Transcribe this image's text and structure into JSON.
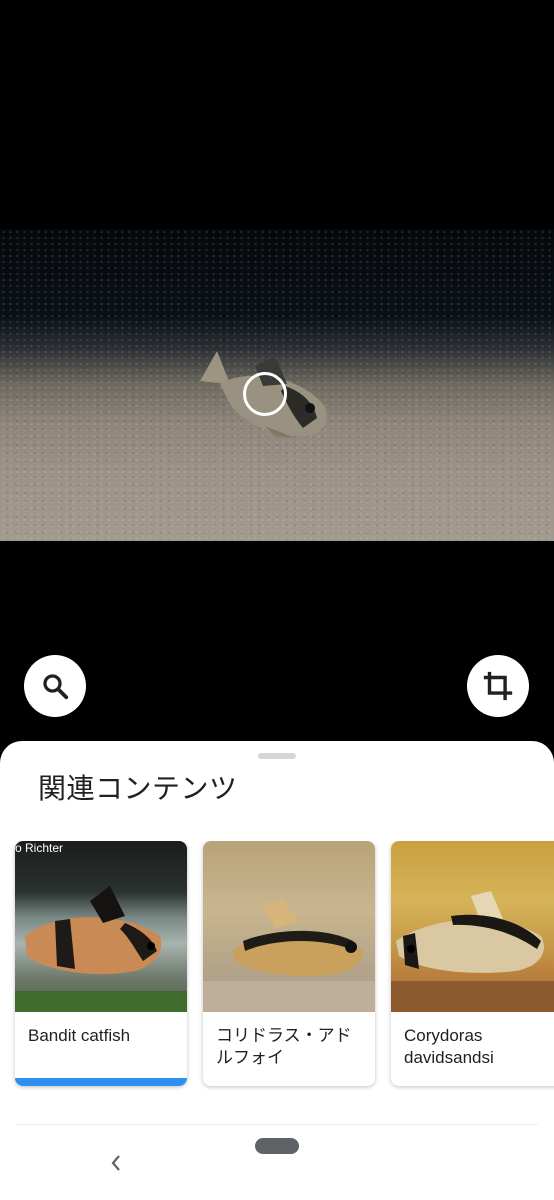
{
  "viewer": {
    "search_icon": "search-icon",
    "crop_icon": "crop-icon"
  },
  "sheet": {
    "title": "関連コンテンツ",
    "cards": [
      {
        "label": "Bandit catfish",
        "watermark": "o Richter",
        "progress": 1.0
      },
      {
        "label": "コリドラス・アドルフォイ"
      },
      {
        "label": "Corydoras davidsandsi"
      }
    ]
  },
  "nav": {
    "back_icon": "chevron-left-icon",
    "home_icon": "home-pill"
  },
  "colors": {
    "accent": "#2f8ff0",
    "sheet_bg": "#ffffff",
    "viewer_bg": "#000000"
  }
}
